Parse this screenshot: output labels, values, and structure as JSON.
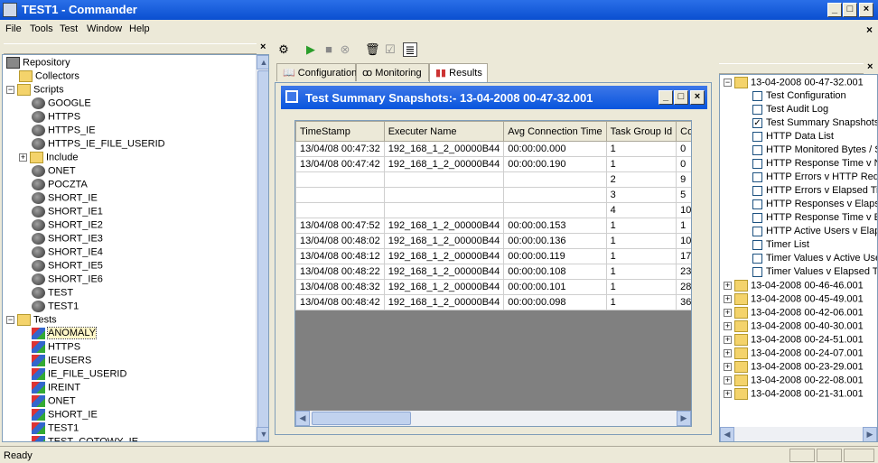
{
  "window": {
    "title": "TEST1 - Commander",
    "min": "_",
    "max": "□",
    "close": "×"
  },
  "menu": [
    "File",
    "Tools",
    "Test",
    "Window",
    "Help"
  ],
  "left_tree": [
    {
      "label": "Repository",
      "icon": "repository-icon",
      "indent": 0,
      "pm": ""
    },
    {
      "label": "Collectors",
      "icon": "folder-icon",
      "indent": 1,
      "pm": ""
    },
    {
      "label": "Scripts",
      "icon": "folder-icon",
      "indent": 0,
      "pm": "-"
    },
    {
      "label": "GOOGLE",
      "icon": "script-icon",
      "indent": 2,
      "pm": ""
    },
    {
      "label": "HTTPS",
      "icon": "script-icon",
      "indent": 2,
      "pm": ""
    },
    {
      "label": "HTTPS_IE",
      "icon": "script-icon",
      "indent": 2,
      "pm": ""
    },
    {
      "label": "HTTPS_IE_FILE_USERID",
      "icon": "script-icon",
      "indent": 2,
      "pm": ""
    },
    {
      "label": "Include",
      "icon": "folder-icon",
      "indent": 1,
      "pm": "+"
    },
    {
      "label": "ONET",
      "icon": "script-icon",
      "indent": 2,
      "pm": ""
    },
    {
      "label": "POCZTA",
      "icon": "script-icon",
      "indent": 2,
      "pm": ""
    },
    {
      "label": "SHORT_IE",
      "icon": "script-icon",
      "indent": 2,
      "pm": ""
    },
    {
      "label": "SHORT_IE1",
      "icon": "script-icon",
      "indent": 2,
      "pm": ""
    },
    {
      "label": "SHORT_IE2",
      "icon": "script-icon",
      "indent": 2,
      "pm": ""
    },
    {
      "label": "SHORT_IE3",
      "icon": "script-icon",
      "indent": 2,
      "pm": ""
    },
    {
      "label": "SHORT_IE4",
      "icon": "script-icon",
      "indent": 2,
      "pm": ""
    },
    {
      "label": "SHORT_IE5",
      "icon": "script-icon",
      "indent": 2,
      "pm": ""
    },
    {
      "label": "SHORT_IE6",
      "icon": "script-icon",
      "indent": 2,
      "pm": ""
    },
    {
      "label": "TEST",
      "icon": "script-icon",
      "indent": 2,
      "pm": ""
    },
    {
      "label": "TEST1",
      "icon": "script-icon",
      "indent": 2,
      "pm": ""
    },
    {
      "label": "Tests",
      "icon": "folder-icon",
      "indent": 0,
      "pm": "-"
    },
    {
      "label": "ANOMALY",
      "icon": "test-icon",
      "indent": 2,
      "pm": "",
      "selected": true
    },
    {
      "label": "HTTPS",
      "icon": "test-icon",
      "indent": 2,
      "pm": ""
    },
    {
      "label": "IEUSERS",
      "icon": "test-icon",
      "indent": 2,
      "pm": ""
    },
    {
      "label": "IE_FILE_USERID",
      "icon": "test-icon",
      "indent": 2,
      "pm": ""
    },
    {
      "label": "IREINT",
      "icon": "test-icon",
      "indent": 2,
      "pm": ""
    },
    {
      "label": "ONET",
      "icon": "test-icon",
      "indent": 2,
      "pm": ""
    },
    {
      "label": "SHORT_IE",
      "icon": "test-icon",
      "indent": 2,
      "pm": ""
    },
    {
      "label": "TEST1",
      "icon": "test-icon",
      "indent": 2,
      "pm": ""
    },
    {
      "label": "TEST_COTOWY_IE",
      "icon": "test-icon",
      "indent": 2,
      "pm": ""
    }
  ],
  "tabs": [
    {
      "label": "Configuration",
      "icon": "book-icon"
    },
    {
      "label": "Monitoring",
      "icon": "glasses-icon"
    },
    {
      "label": "Results",
      "icon": "bar-chart-icon",
      "active": true
    }
  ],
  "snapshot_window": {
    "title": "Test Summary Snapshots:- 13-04-2008 00-47-32.001"
  },
  "table": {
    "columns": [
      "TimeStamp",
      "Executer Name",
      "Avg Connection Time",
      "Task Group Id",
      "Complet"
    ],
    "rows": [
      [
        "13/04/08 00:47:32",
        "192_168_1_2_00000B44",
        "00:00:00.000",
        "1",
        "0"
      ],
      [
        "13/04/08 00:47:42",
        "192_168_1_2_00000B44",
        "00:00:00.190",
        "1",
        "0"
      ],
      [
        "",
        "",
        "",
        "2",
        "9"
      ],
      [
        "",
        "",
        "",
        "3",
        "5"
      ],
      [
        "",
        "",
        "",
        "4",
        "10"
      ],
      [
        "13/04/08 00:47:52",
        "192_168_1_2_00000B44",
        "00:00:00.153",
        "1",
        "1"
      ],
      [
        "13/04/08 00:48:02",
        "192_168_1_2_00000B44",
        "00:00:00.136",
        "1",
        "10"
      ],
      [
        "13/04/08 00:48:12",
        "192_168_1_2_00000B44",
        "00:00:00.119",
        "1",
        "17"
      ],
      [
        "13/04/08 00:48:22",
        "192_168_1_2_00000B44",
        "00:00:00.108",
        "1",
        "23"
      ],
      [
        "13/04/08 00:48:32",
        "192_168_1_2_00000B44",
        "00:00:00.101",
        "1",
        "28"
      ],
      [
        "13/04/08 00:48:42",
        "192_168_1_2_00000B44",
        "00:00:00.098",
        "1",
        "36"
      ]
    ]
  },
  "right_tree": {
    "root": "13-04-2008 00-47-32.001",
    "children": [
      {
        "label": "Test Configuration",
        "checked": false
      },
      {
        "label": "Test Audit Log",
        "checked": false
      },
      {
        "label": "Test Summary Snapshots",
        "checked": true
      },
      {
        "label": "HTTP Data List",
        "checked": false
      },
      {
        "label": "HTTP Monitored Bytes / Sec",
        "checked": false
      },
      {
        "label": "HTTP Response Time v Num",
        "checked": false
      },
      {
        "label": "HTTP Errors v HTTP Reques",
        "checked": false
      },
      {
        "label": "HTTP Errors v Elapsed Time",
        "checked": false
      },
      {
        "label": "HTTP Responses v Elapsed",
        "checked": false
      },
      {
        "label": "HTTP Response Time v Elap",
        "checked": false
      },
      {
        "label": "HTTP Active Users v Elapse",
        "checked": false
      },
      {
        "label": "Timer List",
        "checked": false
      },
      {
        "label": "Timer Values v Active Users",
        "checked": false
      },
      {
        "label": "Timer Values v Elapsed Time",
        "checked": false
      }
    ],
    "others": [
      "13-04-2008 00-46-46.001",
      "13-04-2008 00-45-49.001",
      "13-04-2008 00-42-06.001",
      "13-04-2008 00-40-30.001",
      "13-04-2008 00-24-51.001",
      "13-04-2008 00-24-07.001",
      "13-04-2008 00-23-29.001",
      "13-04-2008 00-22-08.001",
      "13-04-2008 00-21-31.001"
    ]
  },
  "status": "Ready"
}
